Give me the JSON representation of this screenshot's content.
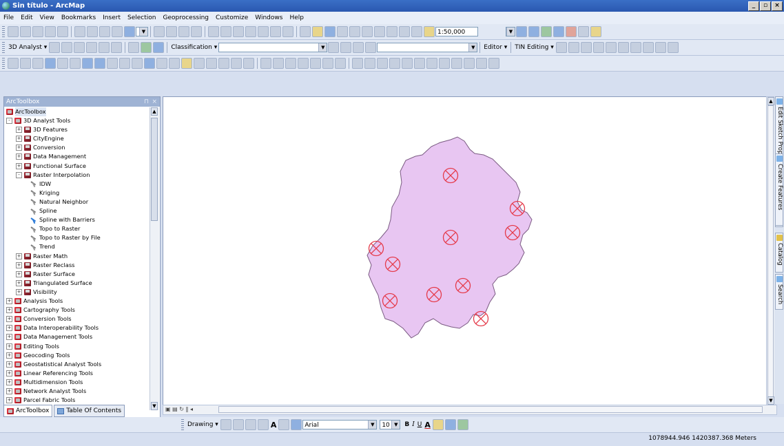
{
  "window": {
    "title": "Sin título - ArcMap",
    "buttons": [
      "_",
      "▫",
      "×"
    ]
  },
  "menu": [
    "File",
    "Edit",
    "View",
    "Bookmarks",
    "Insert",
    "Selection",
    "Geoprocessing",
    "Customize",
    "Windows",
    "Help"
  ],
  "standard_toolbar": {
    "scale": "1:50,000"
  },
  "toolbar2": {
    "analyst3d": "3D Analyst ▾",
    "classification": "Classification ▾",
    "editor": "Editor ▾",
    "tin_editing": "TIN Editing ▾"
  },
  "toolbox_panel": {
    "header": "ArcToolbox",
    "pin": "⊓",
    "close": "×",
    "root": "ArcToolbox",
    "items": [
      {
        "label": "3D Analyst Tools",
        "level": 1,
        "type": "toolbox",
        "expand": "-"
      },
      {
        "label": "3D Features",
        "level": 2,
        "type": "toolset",
        "expand": "+"
      },
      {
        "label": "CityEngine",
        "level": 2,
        "type": "toolset",
        "expand": "+"
      },
      {
        "label": "Conversion",
        "level": 2,
        "type": "toolset",
        "expand": "+"
      },
      {
        "label": "Data Management",
        "level": 2,
        "type": "toolset",
        "expand": "+"
      },
      {
        "label": "Functional Surface",
        "level": 2,
        "type": "toolset",
        "expand": "+"
      },
      {
        "label": "Raster Interpolation",
        "level": 2,
        "type": "toolset",
        "expand": "-"
      },
      {
        "label": "IDW",
        "level": 3,
        "type": "tool"
      },
      {
        "label": "Kriging",
        "level": 3,
        "type": "tool"
      },
      {
        "label": "Natural Neighbor",
        "level": 3,
        "type": "tool"
      },
      {
        "label": "Spline",
        "level": 3,
        "type": "tool"
      },
      {
        "label": "Spline with Barriers",
        "level": 3,
        "type": "tool-blue"
      },
      {
        "label": "Topo to Raster",
        "level": 3,
        "type": "tool"
      },
      {
        "label": "Topo to Raster by File",
        "level": 3,
        "type": "tool"
      },
      {
        "label": "Trend",
        "level": 3,
        "type": "tool"
      },
      {
        "label": "Raster Math",
        "level": 2,
        "type": "toolset",
        "expand": "+"
      },
      {
        "label": "Raster Reclass",
        "level": 2,
        "type": "toolset",
        "expand": "+"
      },
      {
        "label": "Raster Surface",
        "level": 2,
        "type": "toolset",
        "expand": "+"
      },
      {
        "label": "Triangulated Surface",
        "level": 2,
        "type": "toolset",
        "expand": "+"
      },
      {
        "label": "Visibility",
        "level": 2,
        "type": "toolset",
        "expand": "+"
      },
      {
        "label": "Analysis Tools",
        "level": 1,
        "type": "toolbox",
        "expand": "+"
      },
      {
        "label": "Cartography Tools",
        "level": 1,
        "type": "toolbox",
        "expand": "+"
      },
      {
        "label": "Conversion Tools",
        "level": 1,
        "type": "toolbox",
        "expand": "+"
      },
      {
        "label": "Data Interoperability Tools",
        "level": 1,
        "type": "toolbox",
        "expand": "+"
      },
      {
        "label": "Data Management Tools",
        "level": 1,
        "type": "toolbox",
        "expand": "+"
      },
      {
        "label": "Editing Tools",
        "level": 1,
        "type": "toolbox",
        "expand": "+"
      },
      {
        "label": "Geocoding Tools",
        "level": 1,
        "type": "toolbox",
        "expand": "+"
      },
      {
        "label": "Geostatistical Analyst Tools",
        "level": 1,
        "type": "toolbox",
        "expand": "+"
      },
      {
        "label": "Linear Referencing Tools",
        "level": 1,
        "type": "toolbox",
        "expand": "+"
      },
      {
        "label": "Multidimension Tools",
        "level": 1,
        "type": "toolbox",
        "expand": "+"
      },
      {
        "label": "Network Analyst Tools",
        "level": 1,
        "type": "toolbox",
        "expand": "+"
      },
      {
        "label": "Parcel Fabric Tools",
        "level": 1,
        "type": "toolbox",
        "expand": "+"
      }
    ],
    "tabs": [
      "ArcToolbox",
      "Table Of Contents"
    ]
  },
  "right_dock": [
    "Edit Sketch Properties",
    "Create Features",
    "Catalog",
    "Search"
  ],
  "drawing_toolbar": {
    "drawing": "Drawing ▾",
    "font": "Arial",
    "size": "10",
    "bold": "B",
    "italic": "I",
    "underline": "U"
  },
  "status": {
    "coords": "1078944.946  1420387.368 Meters"
  },
  "colors": {
    "polygon_fill": "#e8c6f2",
    "polygon_stroke": "#7a5a82",
    "marker": "#e53a4a"
  }
}
